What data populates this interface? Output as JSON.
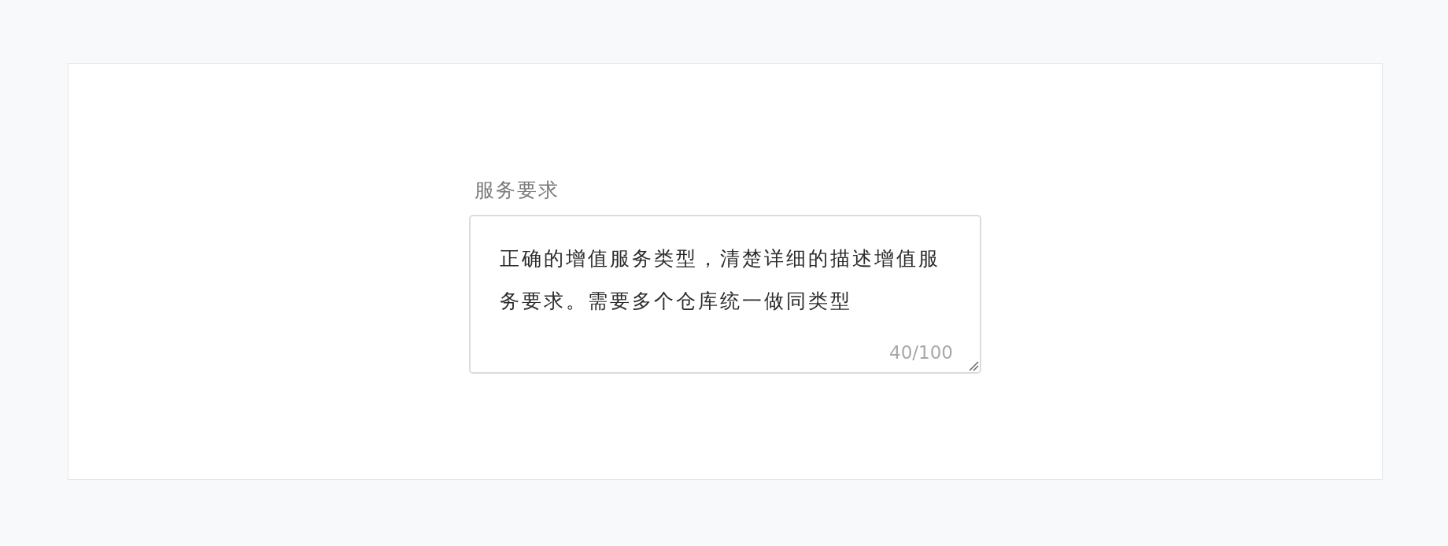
{
  "field": {
    "label": "服务要求",
    "value": "正确的增值服务类型，清楚详细的描述增值服务要求。需要多个仓库统一做同类型",
    "counter": "40/100"
  }
}
